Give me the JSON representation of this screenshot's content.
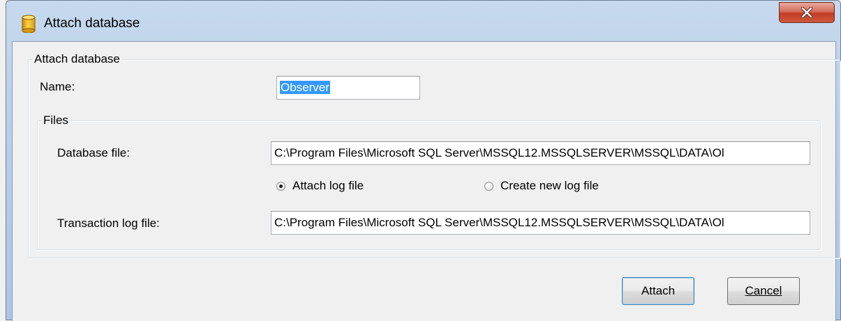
{
  "window": {
    "title": "Attach database",
    "title_icon": "database-icon",
    "close_icon": "close-icon"
  },
  "attach_group": {
    "legend": "Attach database",
    "name_label": "Name:",
    "name_value": "Observer"
  },
  "files_group": {
    "legend": "Files",
    "database_file_label": "Database file:",
    "database_file_value": "C:\\Program Files\\Microsoft SQL Server\\MSSQL12.MSSQLSERVER\\MSSQL\\DATA\\Ol",
    "log_options": [
      {
        "label": "Attach log file",
        "checked": true
      },
      {
        "label": "Create new log file",
        "checked": false
      }
    ],
    "transaction_log_label": "Transaction log file:",
    "transaction_log_value": "C:\\Program Files\\Microsoft SQL Server\\MSSQL12.MSSQLSERVER\\MSSQL\\DATA\\Ol"
  },
  "buttons": {
    "attach": "Attach",
    "cancel": "Cancel"
  },
  "colors": {
    "selection": "#3399ff",
    "close_button": "#c23c23",
    "titlebar": "#b9cfe9"
  }
}
